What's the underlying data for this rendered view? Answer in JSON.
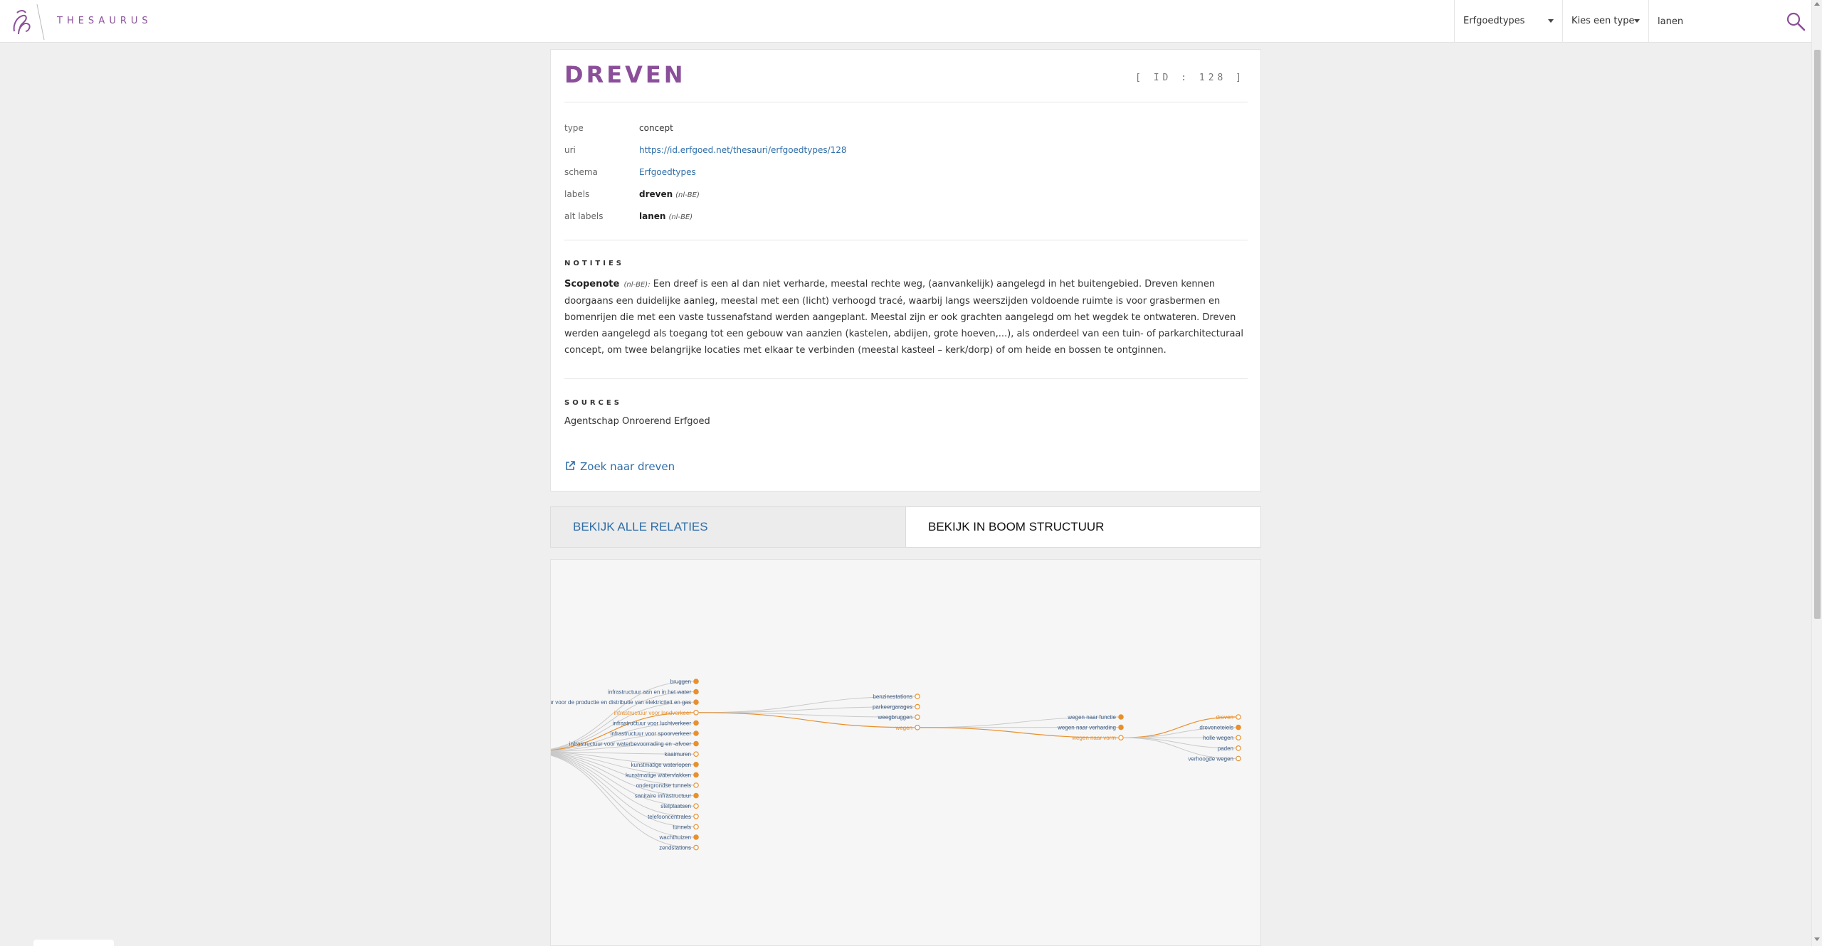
{
  "header": {
    "brand": "THESAURUS",
    "schema_select": "Erfgoedtypes",
    "type_select": "Kies een type",
    "search_value": "lanen"
  },
  "concept": {
    "title": "DREVEN",
    "id_label": "[ ID : 128 ]",
    "props": {
      "type_key": "type",
      "type_val": "concept",
      "uri_key": "uri",
      "uri_val": "https://id.erfgoed.net/thesauri/erfgoedtypes/128",
      "schema_key": "schema",
      "schema_val": "Erfgoedtypes",
      "labels_key": "labels",
      "labels_val": "dreven",
      "labels_lang": "(nl-BE)",
      "alt_key": "alt labels",
      "alt_val": "lanen",
      "alt_lang": "(nl-BE)"
    },
    "notes_heading": "NOTITIES",
    "note_type": "Scopenote",
    "note_lang": "(nl-BE):",
    "note_text": "Een dreef is een al dan niet verharde, meestal rechte weg, (aanvankelijk) aangelegd in het buitengebied. Dreven kennen doorgaans een duidelijke aanleg, meestal met een (licht) verhoogd tracé, waarbij langs weerszijden voldoende ruimte is voor grasbermen en bomenrijen die met een vaste tussenafstand werden aangeplant. Meestal zijn er ook grachten aangelegd om het wegdek te ontwateren. Dreven werden aangelegd als toegang tot een gebouw van aanzien (kastelen, abdijen, grote hoeven,...), als onderdeel van een tuin- of parkarchitecturaal concept, om twee belangrijke locaties met elkaar te verbinden (meestal kasteel – kerk/dorp) of om heide en bossen te ontginnen.",
    "sources_heading": "SOURCES",
    "source": "Agentschap Onroerend Erfgoed",
    "search_link": "Zoek naar dreven"
  },
  "tabs": {
    "relations": "BEKIJK ALLE RELATIES",
    "tree": "BEKIJK IN BOOM STRUCTUUR"
  },
  "tree": {
    "colors": {
      "active": "#e8902d",
      "link": "#c9c9c9",
      "label": "#3d5d86"
    },
    "columns": [
      {
        "nodes": [
          {
            "label": "bruggen",
            "filled": true
          },
          {
            "label": "infrastructuur aan en in het water",
            "filled": true
          },
          {
            "label": "infrastructuur voor de productie en distributie van elektriciteit en gas",
            "filled": true
          },
          {
            "label": "infrastructuur voor landverkeer",
            "filled": false,
            "active": true
          },
          {
            "label": "infrastructuur voor luchtverkeer",
            "filled": true
          },
          {
            "label": "infrastructuur voor spoorverkeer",
            "filled": true
          },
          {
            "label": "infrastructuur voor waterbevoorrading en -afvoer",
            "filled": true
          },
          {
            "label": "kaaimuren",
            "filled": false
          },
          {
            "label": "kunstmatige waterlopen",
            "filled": true
          },
          {
            "label": "kunstmatige watervlakken",
            "filled": true
          },
          {
            "label": "ondergrondse tunnels",
            "filled": false
          },
          {
            "label": "sanitaire infrastructuur",
            "filled": true
          },
          {
            "label": "stelplaatsen",
            "filled": false
          },
          {
            "label": "telefooncentrales",
            "filled": false
          },
          {
            "label": "tunnels",
            "filled": false
          },
          {
            "label": "wachthuizen",
            "filled": true
          },
          {
            "label": "zendstations",
            "filled": false
          }
        ]
      },
      {
        "nodes": [
          {
            "label": "benzinestations",
            "filled": false
          },
          {
            "label": "parkeergarages",
            "filled": false
          },
          {
            "label": "weegbruggen",
            "filled": false
          },
          {
            "label": "wegen",
            "filled": false,
            "active": true
          }
        ]
      },
      {
        "nodes": [
          {
            "label": "wegen naar functie",
            "filled": true
          },
          {
            "label": "wegen naar verharding",
            "filled": true
          },
          {
            "label": "wegen naar vorm",
            "filled": false,
            "active": true
          }
        ]
      },
      {
        "nodes": [
          {
            "label": "dreven",
            "filled": false,
            "active": true
          },
          {
            "label": "dreveneteiels",
            "filled": true
          },
          {
            "label": "holle wegen",
            "filled": false
          },
          {
            "label": "paden",
            "filled": false
          },
          {
            "label": "verhoogde wegen",
            "filled": false
          }
        ]
      }
    ]
  }
}
